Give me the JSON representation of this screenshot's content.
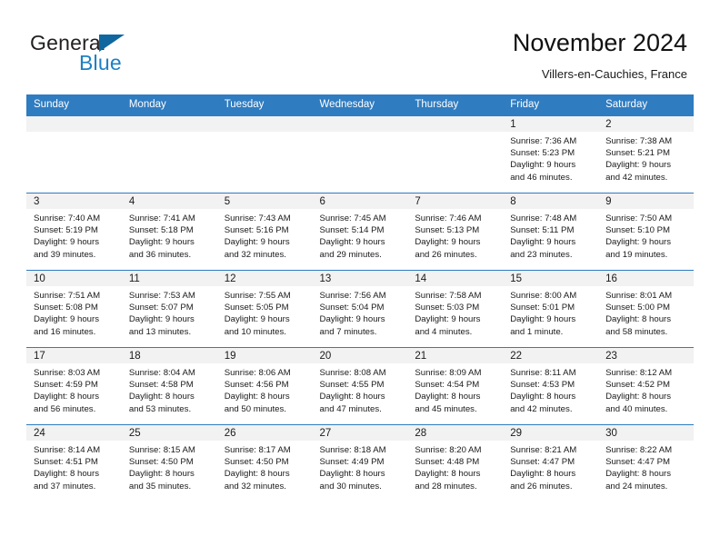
{
  "brand": {
    "word1": "General",
    "word2": "Blue",
    "logo_icon": "triangle-icon",
    "accent_color": "#1d7fc4"
  },
  "header": {
    "title": "November 2024",
    "location": "Villers-en-Cauchies, France"
  },
  "colors": {
    "header_blue": "#2f7cc1",
    "daynum_band": "#f2f2f2",
    "text": "#1a1a1a"
  },
  "calendar": {
    "weekday_headers": [
      "Sunday",
      "Monday",
      "Tuesday",
      "Wednesday",
      "Thursday",
      "Friday",
      "Saturday"
    ],
    "weeks": [
      [
        {
          "day": "",
          "lines": []
        },
        {
          "day": "",
          "lines": []
        },
        {
          "day": "",
          "lines": []
        },
        {
          "day": "",
          "lines": []
        },
        {
          "day": "",
          "lines": []
        },
        {
          "day": "1",
          "lines": [
            "Sunrise: 7:36 AM",
            "Sunset: 5:23 PM",
            "Daylight: 9 hours",
            "and 46 minutes."
          ]
        },
        {
          "day": "2",
          "lines": [
            "Sunrise: 7:38 AM",
            "Sunset: 5:21 PM",
            "Daylight: 9 hours",
            "and 42 minutes."
          ]
        }
      ],
      [
        {
          "day": "3",
          "lines": [
            "Sunrise: 7:40 AM",
            "Sunset: 5:19 PM",
            "Daylight: 9 hours",
            "and 39 minutes."
          ]
        },
        {
          "day": "4",
          "lines": [
            "Sunrise: 7:41 AM",
            "Sunset: 5:18 PM",
            "Daylight: 9 hours",
            "and 36 minutes."
          ]
        },
        {
          "day": "5",
          "lines": [
            "Sunrise: 7:43 AM",
            "Sunset: 5:16 PM",
            "Daylight: 9 hours",
            "and 32 minutes."
          ]
        },
        {
          "day": "6",
          "lines": [
            "Sunrise: 7:45 AM",
            "Sunset: 5:14 PM",
            "Daylight: 9 hours",
            "and 29 minutes."
          ]
        },
        {
          "day": "7",
          "lines": [
            "Sunrise: 7:46 AM",
            "Sunset: 5:13 PM",
            "Daylight: 9 hours",
            "and 26 minutes."
          ]
        },
        {
          "day": "8",
          "lines": [
            "Sunrise: 7:48 AM",
            "Sunset: 5:11 PM",
            "Daylight: 9 hours",
            "and 23 minutes."
          ]
        },
        {
          "day": "9",
          "lines": [
            "Sunrise: 7:50 AM",
            "Sunset: 5:10 PM",
            "Daylight: 9 hours",
            "and 19 minutes."
          ]
        }
      ],
      [
        {
          "day": "10",
          "lines": [
            "Sunrise: 7:51 AM",
            "Sunset: 5:08 PM",
            "Daylight: 9 hours",
            "and 16 minutes."
          ]
        },
        {
          "day": "11",
          "lines": [
            "Sunrise: 7:53 AM",
            "Sunset: 5:07 PM",
            "Daylight: 9 hours",
            "and 13 minutes."
          ]
        },
        {
          "day": "12",
          "lines": [
            "Sunrise: 7:55 AM",
            "Sunset: 5:05 PM",
            "Daylight: 9 hours",
            "and 10 minutes."
          ]
        },
        {
          "day": "13",
          "lines": [
            "Sunrise: 7:56 AM",
            "Sunset: 5:04 PM",
            "Daylight: 9 hours",
            "and 7 minutes."
          ]
        },
        {
          "day": "14",
          "lines": [
            "Sunrise: 7:58 AM",
            "Sunset: 5:03 PM",
            "Daylight: 9 hours",
            "and 4 minutes."
          ]
        },
        {
          "day": "15",
          "lines": [
            "Sunrise: 8:00 AM",
            "Sunset: 5:01 PM",
            "Daylight: 9 hours",
            "and 1 minute."
          ]
        },
        {
          "day": "16",
          "lines": [
            "Sunrise: 8:01 AM",
            "Sunset: 5:00 PM",
            "Daylight: 8 hours",
            "and 58 minutes."
          ]
        }
      ],
      [
        {
          "day": "17",
          "lines": [
            "Sunrise: 8:03 AM",
            "Sunset: 4:59 PM",
            "Daylight: 8 hours",
            "and 56 minutes."
          ]
        },
        {
          "day": "18",
          "lines": [
            "Sunrise: 8:04 AM",
            "Sunset: 4:58 PM",
            "Daylight: 8 hours",
            "and 53 minutes."
          ]
        },
        {
          "day": "19",
          "lines": [
            "Sunrise: 8:06 AM",
            "Sunset: 4:56 PM",
            "Daylight: 8 hours",
            "and 50 minutes."
          ]
        },
        {
          "day": "20",
          "lines": [
            "Sunrise: 8:08 AM",
            "Sunset: 4:55 PM",
            "Daylight: 8 hours",
            "and 47 minutes."
          ]
        },
        {
          "day": "21",
          "lines": [
            "Sunrise: 8:09 AM",
            "Sunset: 4:54 PM",
            "Daylight: 8 hours",
            "and 45 minutes."
          ]
        },
        {
          "day": "22",
          "lines": [
            "Sunrise: 8:11 AM",
            "Sunset: 4:53 PM",
            "Daylight: 8 hours",
            "and 42 minutes."
          ]
        },
        {
          "day": "23",
          "lines": [
            "Sunrise: 8:12 AM",
            "Sunset: 4:52 PM",
            "Daylight: 8 hours",
            "and 40 minutes."
          ]
        }
      ],
      [
        {
          "day": "24",
          "lines": [
            "Sunrise: 8:14 AM",
            "Sunset: 4:51 PM",
            "Daylight: 8 hours",
            "and 37 minutes."
          ]
        },
        {
          "day": "25",
          "lines": [
            "Sunrise: 8:15 AM",
            "Sunset: 4:50 PM",
            "Daylight: 8 hours",
            "and 35 minutes."
          ]
        },
        {
          "day": "26",
          "lines": [
            "Sunrise: 8:17 AM",
            "Sunset: 4:50 PM",
            "Daylight: 8 hours",
            "and 32 minutes."
          ]
        },
        {
          "day": "27",
          "lines": [
            "Sunrise: 8:18 AM",
            "Sunset: 4:49 PM",
            "Daylight: 8 hours",
            "and 30 minutes."
          ]
        },
        {
          "day": "28",
          "lines": [
            "Sunrise: 8:20 AM",
            "Sunset: 4:48 PM",
            "Daylight: 8 hours",
            "and 28 minutes."
          ]
        },
        {
          "day": "29",
          "lines": [
            "Sunrise: 8:21 AM",
            "Sunset: 4:47 PM",
            "Daylight: 8 hours",
            "and 26 minutes."
          ]
        },
        {
          "day": "30",
          "lines": [
            "Sunrise: 8:22 AM",
            "Sunset: 4:47 PM",
            "Daylight: 8 hours",
            "and 24 minutes."
          ]
        }
      ]
    ]
  }
}
